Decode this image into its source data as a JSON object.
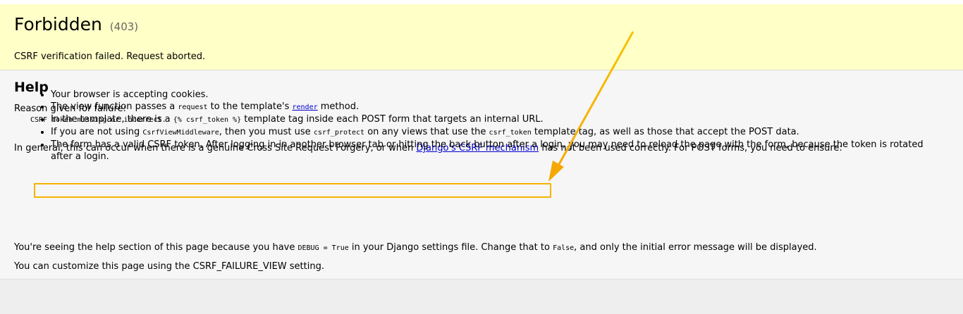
{
  "summary": {
    "title": "Forbidden",
    "status_code": "(403)",
    "message": "CSRF verification failed. Request aborted."
  },
  "help": {
    "heading": "Help",
    "reason_label": "Reason given for failure:",
    "reason_text": "CSRF token missing or incorrect.",
    "general_pre": "In general, this can occur when there is a genuine Cross Site Request Forgery, or when ",
    "general_link": "Django's CSRF mechanism",
    "general_post": " has not been used correctly. For POST forms, you need to ensure:",
    "tips": {
      "t1": "Your browser is accepting cookies.",
      "t2_pre": "The view function passes a ",
      "t2_code": "request",
      "t2_mid": " to the template's ",
      "t2_link": "render",
      "t2_post": " method.",
      "t3_pre": "In the template, there is a ",
      "t3_code": "{% csrf_token %}",
      "t3_post": " template tag inside each POST form that targets an internal URL.",
      "t4_pre": "If you are not using ",
      "t4_code1": "CsrfViewMiddleware",
      "t4_mid1": ", then you must use ",
      "t4_code2": "csrf_protect",
      "t4_mid2": " on any views that use the ",
      "t4_code3": "csrf_token",
      "t4_post": " template tag, as well as those that accept the POST data.",
      "t5": "The form has a valid CSRF token. After logging in in another browser tab or hitting the back button after a login, you may need to reload the page with the form, because the token is rotated after a login."
    },
    "debug_pre": "You're seeing the help section of this page because you have ",
    "debug_code1": "DEBUG = True",
    "debug_mid": " in your Django settings file. Change that to ",
    "debug_code2": "False",
    "debug_post": ", and only the initial error message will be displayed.",
    "customize": "You can customize this page using the CSRF_FAILURE_VIEW setting."
  },
  "annotation": {
    "color": "#f5b400"
  }
}
